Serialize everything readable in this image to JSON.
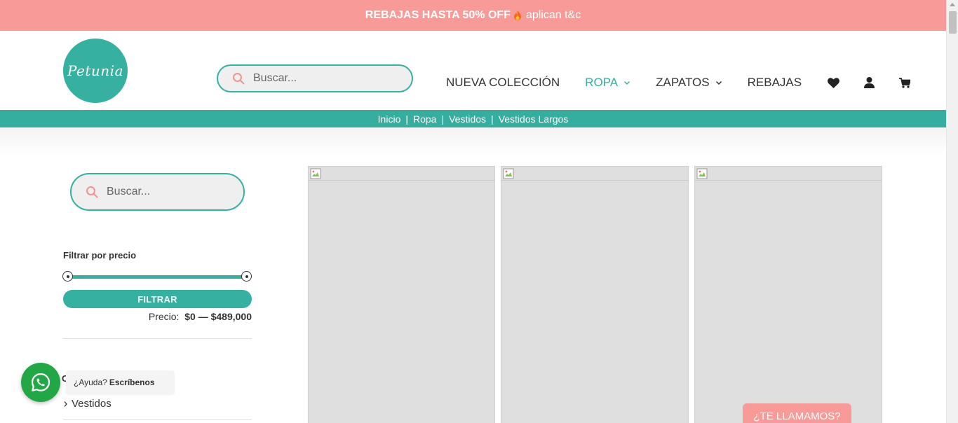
{
  "promo": {
    "headline": "REBAJAS HASTA 50% OFF",
    "terms": "aplican t&c",
    "icon": "flame-icon"
  },
  "header": {
    "logo_text": "Petunia",
    "search_placeholder": "Buscar...",
    "nav": [
      {
        "label": "NUEVA COLECCIÓN",
        "active": false,
        "dropdown": false
      },
      {
        "label": "ROPA",
        "active": true,
        "dropdown": true
      },
      {
        "label": "ZAPATOS",
        "active": false,
        "dropdown": true
      },
      {
        "label": "REBAJAS",
        "active": false,
        "dropdown": false
      }
    ],
    "icons": [
      "heart-icon",
      "user-icon",
      "cart-icon"
    ]
  },
  "breadcrumb": {
    "items": [
      "Inicio",
      "Ropa",
      "Vestidos",
      "Vestidos Largos"
    ],
    "separator": "|"
  },
  "sidebar": {
    "search_placeholder": "Buscar...",
    "filter_title": "Filtrar por precio",
    "filter_button": "FILTRAR",
    "price_label": "Precio:",
    "price_min": "$0",
    "price_dash": "—",
    "price_max": "$489,000",
    "categories": [
      {
        "label": "Vestidos"
      }
    ]
  },
  "whatsapp": {
    "tooltip_prefix": "¿Ayuda?",
    "tooltip_bold": "Escríbenos",
    "peek_letter": "C"
  },
  "call_button": "¿TE LLAMAMOS?",
  "colors": {
    "accent": "#35b0a1",
    "promo": "#f89b98",
    "whatsapp": "#23a646"
  }
}
